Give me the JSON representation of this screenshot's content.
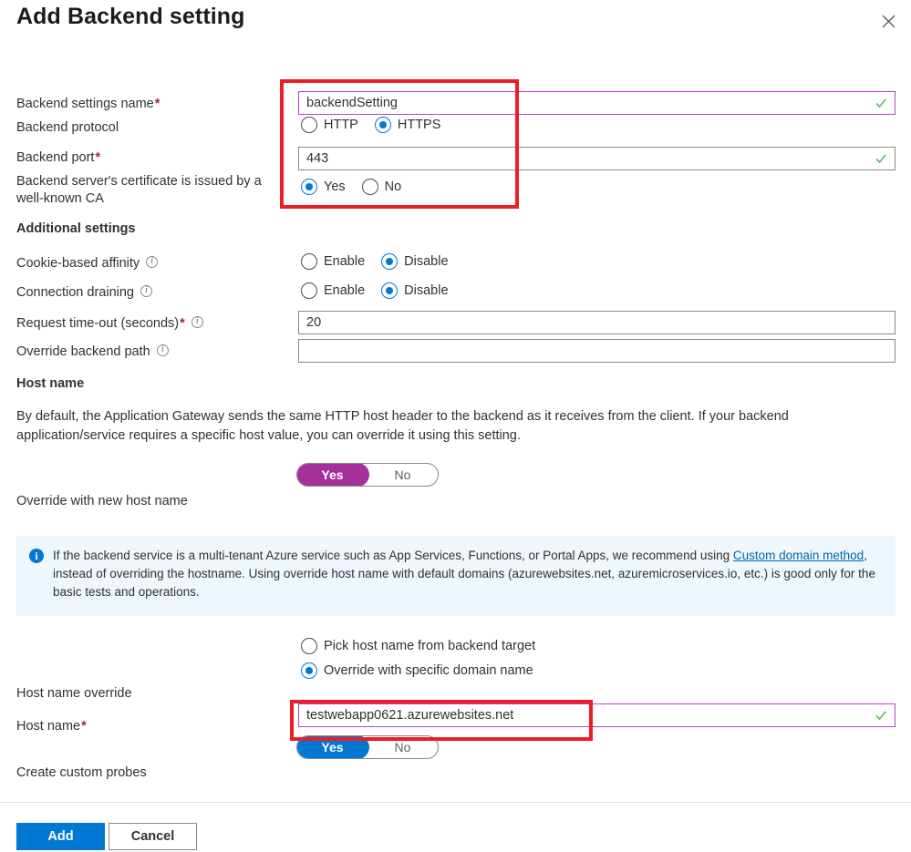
{
  "dialog": {
    "title": "Add Backend setting",
    "close_label": "Close"
  },
  "fields": {
    "backend_settings_name": {
      "label": "Backend settings name",
      "required_mark": "*",
      "value": "backendSetting",
      "validation": "valid"
    },
    "backend_protocol": {
      "label": "Backend protocol",
      "options": [
        "HTTP",
        "HTTPS"
      ],
      "selected": "HTTPS"
    },
    "backend_port": {
      "label": "Backend port",
      "required_mark": "*",
      "value": "443",
      "validation": "valid"
    },
    "well_known_ca": {
      "label": "Backend server's certificate is issued by a well-known CA",
      "options": [
        "Yes",
        "No"
      ],
      "selected": "Yes"
    }
  },
  "additional_settings": {
    "heading": "Additional settings",
    "cookie_affinity": {
      "label": "Cookie-based affinity",
      "info_icon": "info-icon",
      "options": [
        "Enable",
        "Disable"
      ],
      "selected": "Disable"
    },
    "connection_draining": {
      "label": "Connection draining",
      "info_icon": "info-icon",
      "options": [
        "Enable",
        "Disable"
      ],
      "selected": "Disable"
    },
    "request_timeout": {
      "label": "Request time-out (seconds)",
      "required_mark": "*",
      "info_icon": "info-icon",
      "value": "20"
    },
    "override_backend_path": {
      "label": "Override backend path",
      "info_icon": "info-icon",
      "value": "",
      "placeholder": ""
    }
  },
  "host_name": {
    "heading": "Host name",
    "description": "By default, the Application Gateway sends the same HTTP host header to the backend as it receives from the client. If your backend application/service requires a specific host value, you can override it using this setting.",
    "override_toggle": {
      "label": "Override with new host name",
      "options": [
        "Yes",
        "No"
      ],
      "selected": "Yes",
      "color": "#a4309b"
    },
    "banner": {
      "icon": "info-circle-icon",
      "text_before_link": "If the backend service is a multi-tenant Azure service such as App Services, Functions, or Portal Apps, we recommend using ",
      "link_text": "Custom domain method",
      "text_after_link": ", instead of overriding the hostname. Using override host name with default domains (azurewebsites.net, azuremicroservices.io, etc.) is good only for the basic tests and operations.",
      "background": "#eff6fc"
    },
    "host_name_override": {
      "label": "Host name override",
      "options": [
        "Pick host name from backend target",
        "Override with specific domain name"
      ],
      "selected": "Override with specific domain name"
    },
    "host_name_field": {
      "label": "Host name",
      "required_mark": "*",
      "value": "testwebapp0621.azurewebsites.net",
      "validation": "valid"
    },
    "create_custom_probes": {
      "label": "Create custom probes",
      "options": [
        "Yes",
        "No"
      ],
      "selected": "Yes",
      "color": "#0078d4"
    }
  },
  "footer": {
    "add_label": "Add",
    "cancel_label": "Cancel"
  },
  "annotations": {
    "color": "#ee1c25",
    "boxes": [
      "top-settings-highlight",
      "host-name-highlight"
    ]
  }
}
